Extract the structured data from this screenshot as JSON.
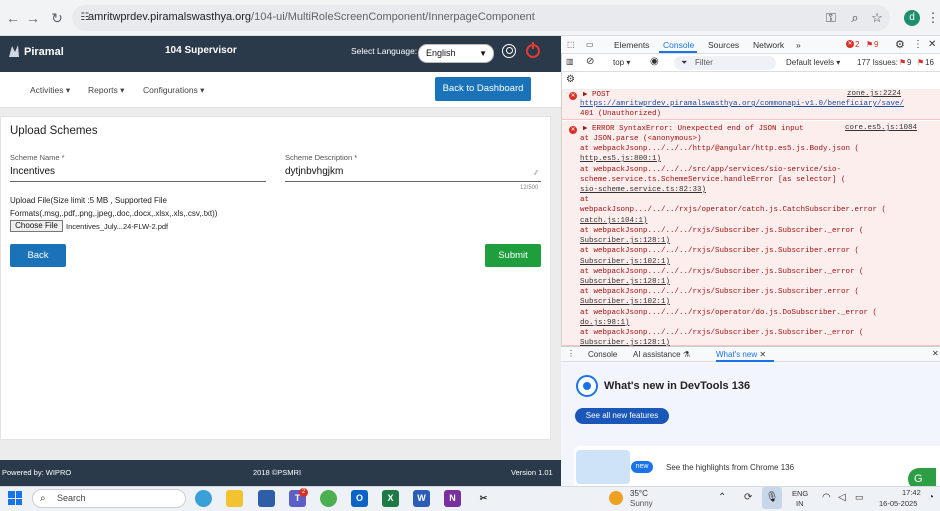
{
  "browser": {
    "url_host": "amritwprdev.piramalswasthya.org",
    "url_path": "/104-ui/MultiRoleScreenComponent/InnerpageComponent",
    "profile_initial": "d"
  },
  "app": {
    "logo_text": "Piramal",
    "title": "104 Supervisor",
    "language_label": "Select Language:",
    "language_value": "English",
    "menu": {
      "activities": "Activities",
      "reports": "Reports",
      "configurations": "Configurations"
    },
    "back_to_dashboard": "Back to Dashboard",
    "card_title": "Upload Schemes",
    "scheme_name_label": "Scheme Name *",
    "scheme_name_value": "Incentives",
    "scheme_desc_label": "Scheme Description *",
    "scheme_desc_value": "dytjnbvhgjkm",
    "char_counter": "12/500",
    "upload_info": "Upload File(Size limit :5 MB , Supported File Formats(.msg,.pdf,.png,.jpeg,.doc,.docx,.xlsx,.xls,.csv,.txt))",
    "choose_file": "Choose File",
    "file_name": "Incentives_July...24-FLW-2.pdf",
    "back": "Back",
    "submit": "Submit",
    "footer_left": "Powered by: WIPRO",
    "footer_mid": "2018 ©PSMRI",
    "footer_right": "Version 1.01"
  },
  "devtools": {
    "tabs": [
      "Elements",
      "Console",
      "Sources",
      "Network"
    ],
    "more_tabs": "»",
    "error_count": "2",
    "warning_count": "9",
    "context": "top",
    "filter_placeholder": "Filter",
    "levels": "Default levels",
    "issues": "177 Issues:",
    "issues_errors": "9",
    "issues_info": "16",
    "error1": {
      "method": "POST",
      "src": "zone.js:2224",
      "url": "https://amritwprdev.piramalswasthya.org/commonapi-v1.0/beneficiary/save/",
      "status": "401 (Unauthorized)"
    },
    "error2": {
      "head": "ERROR SyntaxError: Unexpected end of JSON input",
      "src": "core.es5.js:1084",
      "lines": [
        "    at JSON.parse (<anonymous>)",
        "    at webpackJsonp.../../../http/@angular/http.es5.js.Body.json (",
        "http.es5.js:800:1)",
        "    at webpackJsonp.../../../src/app/services/sio-service/sio-",
        "scheme.service.ts.SchemeService.handleError [as selector] (",
        "sio-scheme.service.ts:82:33)",
        "    at",
        "webpackJsonp.../../../rxjs/operator/catch.js.CatchSubscriber.error (",
        "catch.js:104:1)",
        "    at webpackJsonp.../../../rxjs/Subscriber.js.Subscriber._error (",
        "Subscriber.js:128:1)",
        "    at webpackJsonp.../../../rxjs/Subscriber.js.Subscriber.error (",
        "Subscriber.js:102:1)",
        "    at webpackJsonp.../../../rxjs/Subscriber.js.Subscriber._error (",
        "Subscriber.js:128:1)",
        "    at webpackJsonp.../../../rxjs/Subscriber.js.Subscriber.error (",
        "Subscriber.js:102:1)",
        "    at webpackJsonp.../../../rxjs/operator/do.js.DoSubscriber._error (",
        "do.js:98:1)",
        "    at webpackJsonp.../../../rxjs/Subscriber.js.Subscriber._error (",
        "Subscriber.js:128:1)"
      ]
    },
    "drawer_tabs": {
      "console": "Console",
      "ai": "AI assistance",
      "whats_new": "What's new"
    },
    "whats_new_title": "What's new in DevTools 136",
    "see_all": "See all new features",
    "new_badge": "new",
    "highlights": "See the highlights from Chrome 136"
  },
  "taskbar": {
    "search_placeholder": "Search",
    "weather_temp": "35°C",
    "weather_desc": "Sunny",
    "lang_top": "ENG",
    "lang_bottom": "IN",
    "time": "17:42",
    "date": "16-05-2025",
    "teams_badge": "2"
  }
}
